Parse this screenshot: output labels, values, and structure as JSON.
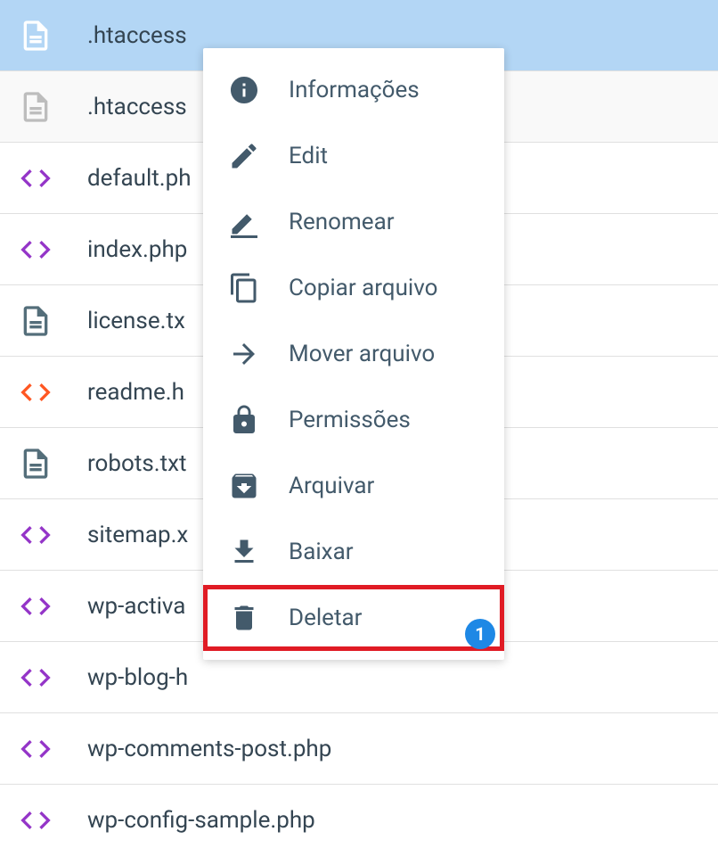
{
  "files": [
    {
      "name": ".htaccess",
      "icon": "file-white",
      "state": "selected"
    },
    {
      "name": ".htaccess",
      "icon": "file-gray",
      "state": "faded"
    },
    {
      "name": "default.ph",
      "icon": "code-purple",
      "state": ""
    },
    {
      "name": "index.php",
      "icon": "code-purple",
      "state": ""
    },
    {
      "name": "license.tx",
      "icon": "file-dark",
      "state": ""
    },
    {
      "name": "readme.h",
      "icon": "code-orange",
      "state": ""
    },
    {
      "name": "robots.txt",
      "icon": "file-dark",
      "state": ""
    },
    {
      "name": "sitemap.x",
      "icon": "code-purple",
      "state": ""
    },
    {
      "name": "wp-activa",
      "icon": "code-purple",
      "state": ""
    },
    {
      "name": "wp-blog-h",
      "icon": "code-purple",
      "state": ""
    },
    {
      "name": "wp-comments-post.php",
      "icon": "code-purple",
      "state": ""
    },
    {
      "name": "wp-config-sample.php",
      "icon": "code-purple",
      "state": ""
    }
  ],
  "contextMenu": {
    "items": [
      {
        "label": "Informações",
        "icon": "info"
      },
      {
        "label": "Edit",
        "icon": "edit"
      },
      {
        "label": "Renomear",
        "icon": "rename"
      },
      {
        "label": "Copiar arquivo",
        "icon": "copy"
      },
      {
        "label": "Mover arquivo",
        "icon": "move"
      },
      {
        "label": "Permissões",
        "icon": "lock"
      },
      {
        "label": "Arquivar",
        "icon": "archive"
      },
      {
        "label": "Baixar",
        "icon": "download"
      },
      {
        "label": "Deletar",
        "icon": "delete",
        "highlighted": true
      }
    ]
  },
  "badge": "1",
  "colors": {
    "selected_bg": "#b3d6f5",
    "menu_icon": "#435a6b",
    "purple": "#9435c8",
    "orange": "#ff5722",
    "dark": "#546e7a",
    "gray": "#bdbdbd",
    "white": "#ffffff",
    "badge": "#1e88e5",
    "highlight": "#e01b24"
  }
}
